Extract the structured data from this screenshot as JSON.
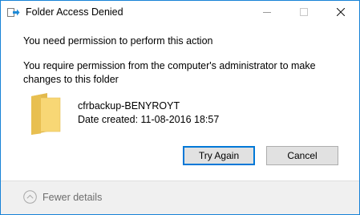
{
  "window": {
    "title": "Folder Access Denied",
    "accent_color": "#1883d7"
  },
  "dialog": {
    "heading": "You need permission to perform this action",
    "message": "You require permission from the computer's administrator to make changes to this folder",
    "item": {
      "icon": "folder-icon",
      "name": "cfrbackup-BENYROYT",
      "date_created": "Date created: 11-08-2016 18:57"
    },
    "buttons": {
      "try_again": "Try Again",
      "cancel": "Cancel"
    }
  },
  "footer": {
    "details_label": "Fewer details",
    "details_icon": "chevron-up-circle-icon"
  },
  "title_controls": [
    "minimize-icon",
    "maximize-icon",
    "close-icon"
  ]
}
